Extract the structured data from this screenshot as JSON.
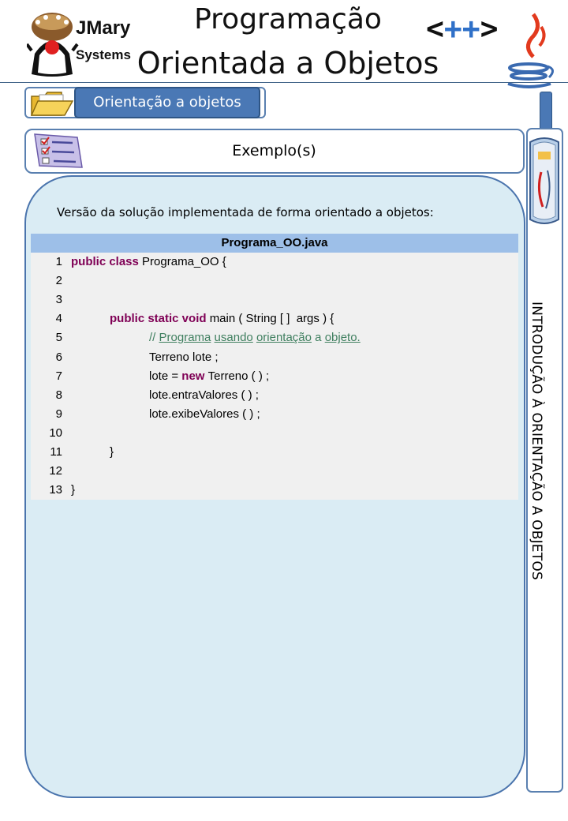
{
  "header": {
    "brand_line1": "JMary",
    "brand_line2": "Systems",
    "title_line1": "Programação",
    "title_line2": "Orientada a Objetos",
    "cpp_left": "<",
    "cpp_plus": "++",
    "cpp_right": ">"
  },
  "topic": {
    "label": "Orientação a objetos"
  },
  "example": {
    "label": "Exemplo(s)"
  },
  "content": {
    "intro": "Versão da solução implementada de forma orientado a objetos:",
    "code_title": "Programa_OO.java",
    "lines": [
      {
        "n": "1",
        "parts": [
          {
            "t": "public class ",
            "c": "kw"
          },
          {
            "t": "Programa_OO {",
            "c": ""
          }
        ]
      },
      {
        "n": "2",
        "parts": []
      },
      {
        "n": "3",
        "parts": []
      },
      {
        "n": "4",
        "parts": [
          {
            "t": "public static void ",
            "c": "kw"
          },
          {
            "t": "main ( String [ ]  args ) {",
            "c": ""
          }
        ]
      },
      {
        "n": "5",
        "parts": [
          {
            "t": "// ",
            "c": "cm"
          },
          {
            "t": "Programa",
            "c": "cmu"
          },
          {
            "t": " ",
            "c": "cm"
          },
          {
            "t": "usando",
            "c": "cmu"
          },
          {
            "t": " ",
            "c": "cm"
          },
          {
            "t": "orientação",
            "c": "cmu"
          },
          {
            "t": " a ",
            "c": "cm"
          },
          {
            "t": "objeto.",
            "c": "cmu"
          }
        ]
      },
      {
        "n": "6",
        "parts": [
          {
            "t": "Terreno lote ;",
            "c": ""
          }
        ]
      },
      {
        "n": "7",
        "parts": [
          {
            "t": "lote = ",
            "c": ""
          },
          {
            "t": "new ",
            "c": "kw"
          },
          {
            "t": "Terreno ( ) ;",
            "c": ""
          }
        ]
      },
      {
        "n": "8",
        "parts": [
          {
            "t": "lote.entraValores ( ) ;",
            "c": ""
          }
        ]
      },
      {
        "n": "9",
        "parts": [
          {
            "t": "lote.exibeValores ( ) ;",
            "c": ""
          }
        ]
      },
      {
        "n": "10",
        "parts": []
      },
      {
        "n": "11",
        "parts": [
          {
            "t": "}",
            "c": ""
          }
        ]
      },
      {
        "n": "12",
        "parts": []
      },
      {
        "n": "13",
        "parts": [
          {
            "t": "}",
            "c": ""
          }
        ]
      }
    ]
  },
  "sidebar": {
    "label": "INTRODUÇÃO À ORIENTAÇÃO A OBJETOS"
  },
  "colors": {
    "accent": "#4a78b5",
    "panel": "#daecf4",
    "code_header": "#9dbfe8",
    "keyword": "#7f0055",
    "comment": "#3f7f5f"
  },
  "icons": [
    "duke-mascot-logo",
    "java-cup-icon",
    "folder-icon",
    "checklist-icon",
    "newspaper-icon"
  ]
}
